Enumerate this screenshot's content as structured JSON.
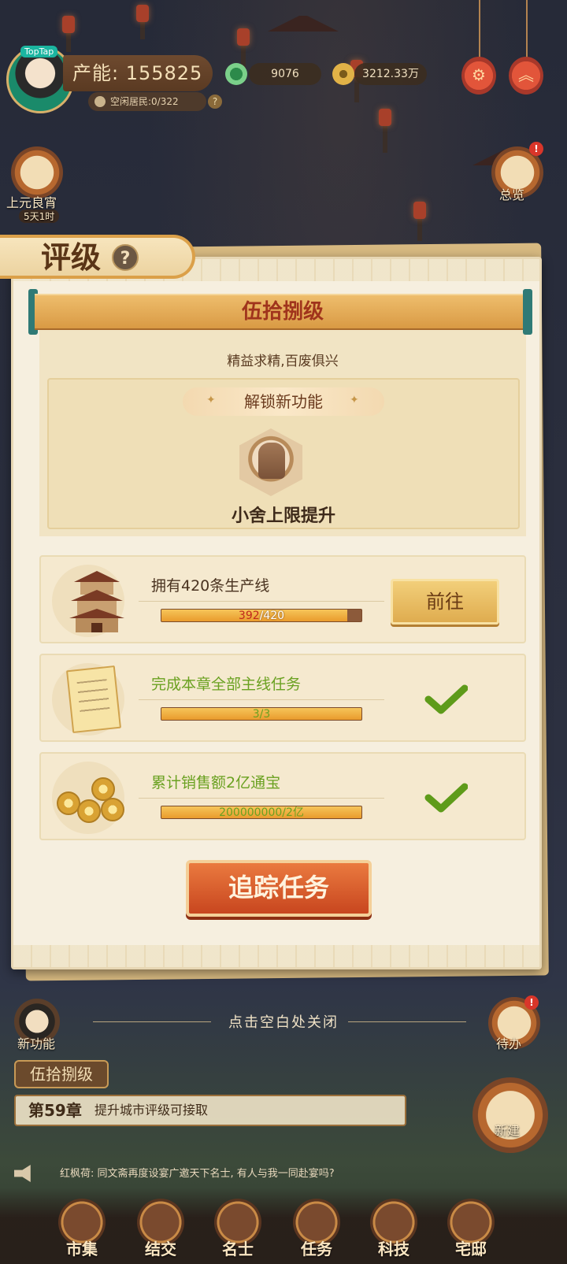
{
  "hud": {
    "badge": "TopTap",
    "power_label": "产能: 155825",
    "idle_residents": "空闲居民:0/322",
    "help": "?",
    "currency_jade": "9076",
    "currency_coin": "3212.33万"
  },
  "side": {
    "event_label": "上元良宵",
    "event_timer": "5天1时",
    "overview_label": "总览",
    "overview_badge": "!",
    "todo_label": "待办",
    "todo_badge": "!",
    "new_feature_label": "新功能",
    "build_label": "新建"
  },
  "panel": {
    "title": "评级",
    "help": "?",
    "level_name": "伍拾捌级",
    "motto": "精益求精,百废俱兴",
    "unlock_header": "解锁新功能",
    "unlock_spark": "✦",
    "unlock_feature": "小舍上限提升",
    "tasks": [
      {
        "text": "拥有420条生产线",
        "current": "392",
        "total": "/420",
        "progress": 0.93,
        "action": "前往",
        "done": false
      },
      {
        "text": "完成本章全部主线任务",
        "progress_label": "3/3",
        "progress": 1.0,
        "done": true
      },
      {
        "text": "累计销售额2亿通宝",
        "progress_label": "200000000/2亿",
        "progress": 1.0,
        "done": true
      }
    ],
    "track_button": "追踪任务"
  },
  "close_hint": "点击空白处关闭",
  "bottom": {
    "level_badge": "伍拾捌级",
    "chapter_num": "第59章",
    "chapter_text": "提升城市评级可接取",
    "chat": "红枫荷: 同文斋再度设宴广邀天下名士, 有人与我一同赴宴吗?"
  },
  "nav": [
    "市集",
    "结交",
    "名士",
    "任务",
    "科技",
    "宅邸"
  ],
  "colors": {
    "accent_orange": "#c8461f",
    "task_green": "#6aa121",
    "progress_gold": "#f6c55a",
    "current_red": "#c0281c"
  }
}
